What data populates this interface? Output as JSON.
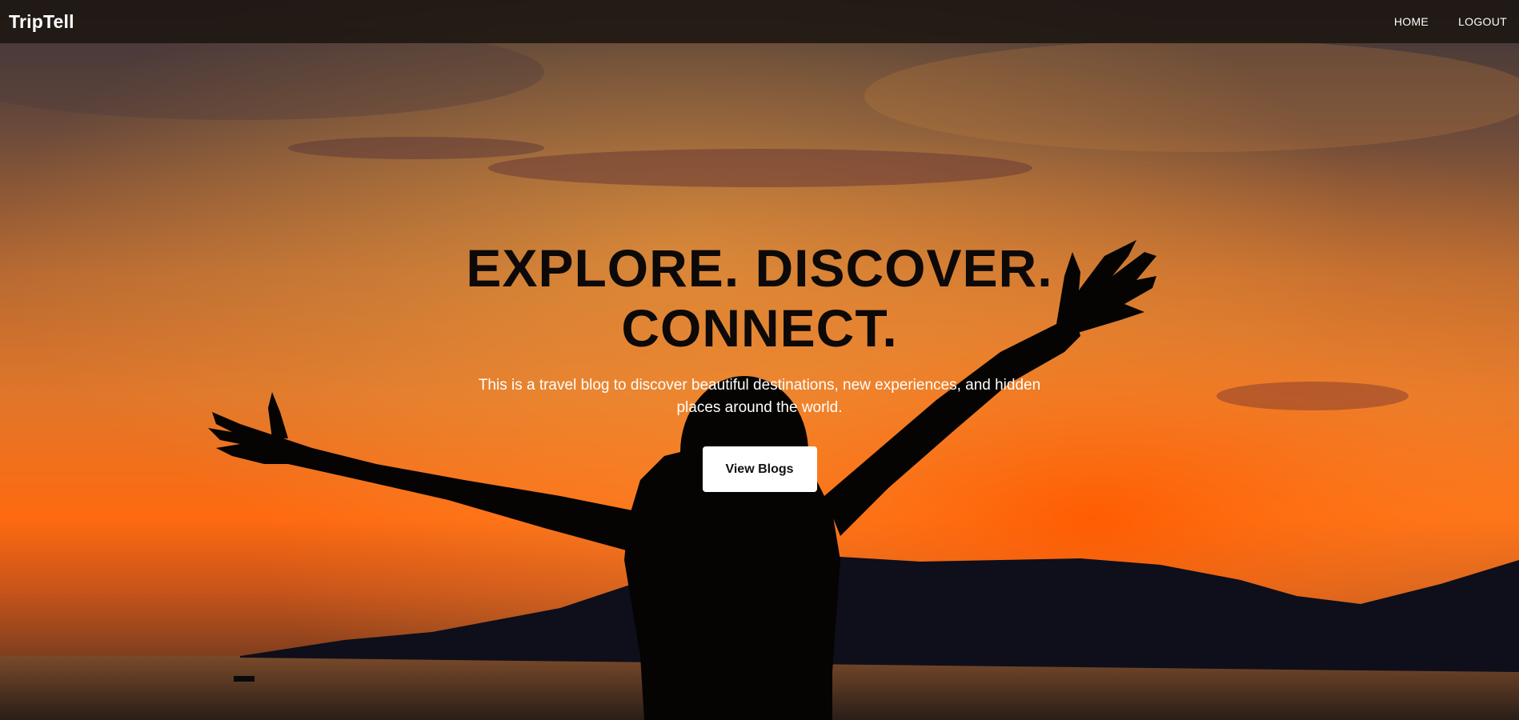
{
  "navbar": {
    "brand": "TripTell",
    "links": [
      {
        "label": "HOME"
      },
      {
        "label": "LOGOUT"
      }
    ]
  },
  "hero": {
    "title_line1": "EXPLORE. DISCOVER.",
    "title_line2": "CONNECT.",
    "description": "This is a travel blog to discover beautiful destinations, new experiences, and hidden places around the world.",
    "cta_label": "View Blogs",
    "background_image": "sunset-silhouette-photo"
  },
  "colors": {
    "navbar_bg": "#1c1610",
    "sky_top": "#3a3540",
    "sunset_orange": "#ff7a1a",
    "title_color": "#0c0908",
    "button_bg": "#ffffff"
  }
}
